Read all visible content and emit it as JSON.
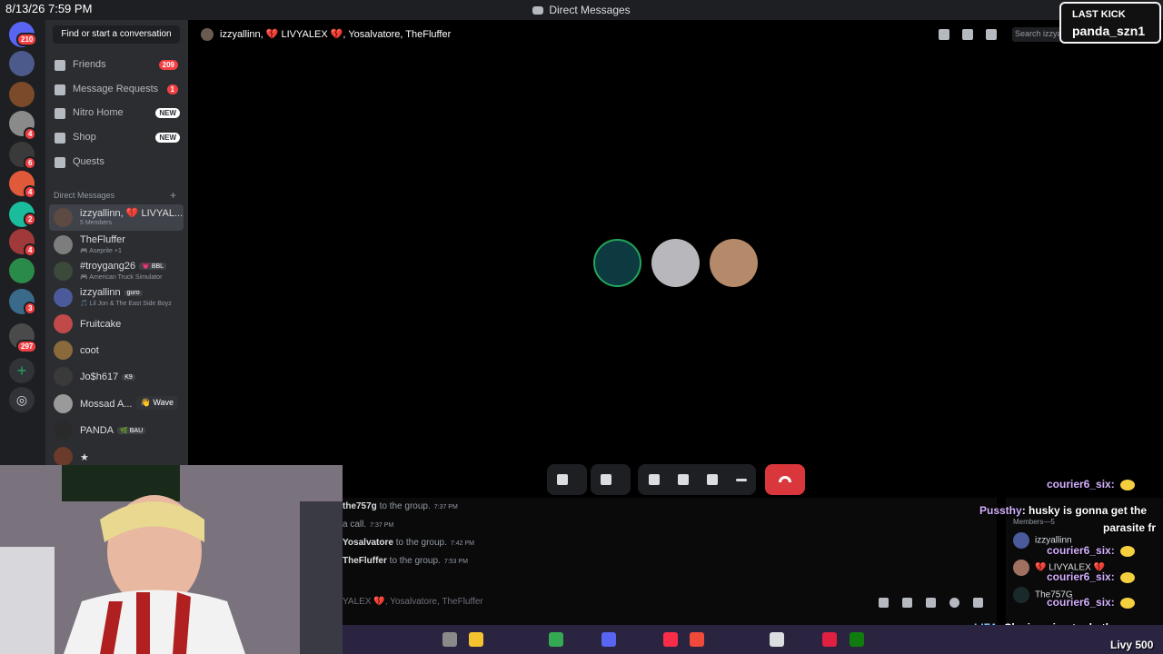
{
  "clock": "8/13/26 7:59 PM",
  "window_title": "Direct Messages",
  "colors": {
    "accent": "#5865f2",
    "danger": "#da373c",
    "badge": "#f23f43",
    "sidebar_bg": "#2b2d31",
    "rail_bg": "#1e1f22"
  },
  "rail": {
    "home_badge": "210",
    "server_badges": [
      "4",
      "6",
      "4",
      "2",
      "4",
      "3",
      "297"
    ],
    "add_server_icon": "plus-icon",
    "discover_icon": "compass-icon"
  },
  "sidebar": {
    "find_button": "Find or start a conversation",
    "nav": [
      {
        "label": "Friends",
        "icon": "friends-icon",
        "badge": "209"
      },
      {
        "label": "Message Requests",
        "icon": "mail-icon",
        "badge": "1"
      },
      {
        "label": "Nitro Home",
        "icon": "nitro-icon",
        "badge": "NEW"
      },
      {
        "label": "Shop",
        "icon": "shop-icon",
        "badge": "NEW"
      },
      {
        "label": "Quests",
        "icon": "quests-icon",
        "badge": ""
      }
    ],
    "dm_header": "Direct Messages",
    "dm_add_icon": "plus-icon",
    "dms": [
      {
        "name": "izzyallinn, 💔 LIVYAL...",
        "sub": "5 Members",
        "tag": "",
        "color": "#5d4a42"
      },
      {
        "name": "TheFluffer",
        "sub": "🎮 Aseprite +1",
        "tag": "",
        "color": "#7d7d7d"
      },
      {
        "name": "#troygang26",
        "sub": "🎮 American Truck Simulator",
        "tag": "💗 BBL",
        "color": "#3c4a3c"
      },
      {
        "name": "izzyallinn",
        "sub": "🎵 Lil Jon & The East Side Boyz",
        "tag": "guro",
        "color": "#4a5a9a"
      },
      {
        "name": "Fruitcake",
        "sub": "",
        "tag": "",
        "color": "#c04a4a"
      },
      {
        "name": "coot",
        "sub": "",
        "tag": "",
        "color": "#8a6a3a"
      },
      {
        "name": "Jo$h617",
        "sub": "",
        "tag": "K9",
        "color": "#3a3a3a"
      },
      {
        "name": "Mossad A...",
        "sub": "",
        "tag": "",
        "wave": "👋 Wave",
        "color": "#9a9a9a"
      },
      {
        "name": "PANDA",
        "sub": "",
        "tag": "🌿 BAU",
        "color": "#2a2a2a"
      },
      {
        "name": "★",
        "sub": "",
        "tag": "",
        "color": "#6a3a2a"
      }
    ]
  },
  "call": {
    "header_title": "izzyallinn, 💔 LIVYALEX 💔, Yosalvatore, TheFluffer",
    "search_placeholder": "Search izzyallinn",
    "header_icons": [
      "pin-icon",
      "add-friend-icon",
      "members-icon"
    ],
    "participants": [
      "757g-avatar",
      "husky-avatar",
      "livyalex-avatar"
    ],
    "controls": [
      "microphone-icon",
      "video-off-icon",
      "screen-share-icon",
      "activities-icon",
      "soundboard-icon",
      "more-icon"
    ],
    "end_call_icon": "hangup-icon"
  },
  "chat_log": [
    {
      "name": "the757g",
      "text": "to the group.",
      "time": "7:37 PM"
    },
    {
      "name": "",
      "text": "a call.",
      "time": "7:37 PM"
    },
    {
      "name": "Yosalvatore",
      "text": "to the group.",
      "time": "7:42 PM"
    },
    {
      "name": "TheFluffer",
      "text": "to the group.",
      "time": "7:53 PM"
    }
  ],
  "composer_placeholder": "YALEX 💔, Yosalvatore, TheFluffer",
  "composer_icons": [
    "gift-icon",
    "gif-icon",
    "sticker-icon",
    "emoji-icon",
    "apps-icon"
  ],
  "members": {
    "header": "Members—5",
    "list": [
      {
        "name": "izzyallinn",
        "tag": "guro",
        "color": "#4a5a9a"
      },
      {
        "name": "💔 LIVYALEX 💔",
        "tag": "",
        "color": "#a07060"
      },
      {
        "name": "The757G",
        "tag": "",
        "color": "#1a2a2a"
      }
    ]
  },
  "overlay": [
    {
      "user": "courier6_six:",
      "msg": ""
    },
    {
      "user": "Pussthy",
      "msg": ": husky is gonna get the"
    },
    {
      "user": "",
      "msg": "parasite fr"
    },
    {
      "user": "courier6_six:",
      "msg": ""
    },
    {
      "user": "courier6_six:",
      "msg": ""
    },
    {
      "user": "courier6_six:",
      "msg": ""
    },
    {
      "user": "LIFA",
      "msg": ": She is going to do the"
    }
  ],
  "stream": {
    "last_kick_label": "LAST KICK",
    "last_kick_user": "panda_szn1",
    "sub_count": "Livy 500"
  }
}
